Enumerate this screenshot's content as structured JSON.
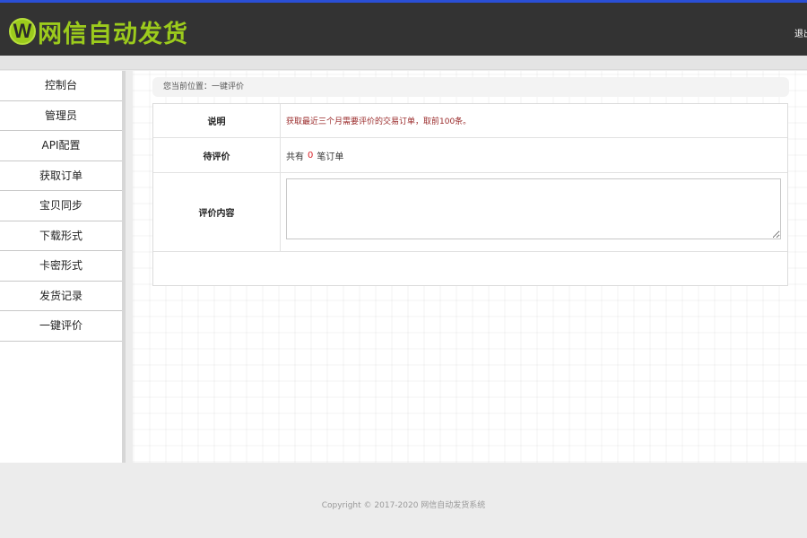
{
  "header": {
    "logo_badge": "W",
    "logo_text": "网信自动发货",
    "logout_label": "退出"
  },
  "sidebar": {
    "items": [
      {
        "label": "控制台"
      },
      {
        "label": "管理员"
      },
      {
        "label": "API配置"
      },
      {
        "label": "获取订单"
      },
      {
        "label": "宝贝同步"
      },
      {
        "label": "下载形式"
      },
      {
        "label": "卡密形式"
      },
      {
        "label": "发货记录"
      },
      {
        "label": "一键评价"
      }
    ]
  },
  "main": {
    "breadcrumb": "您当前位置：一键评价",
    "rows": {
      "desc_label": "说明",
      "desc_value": "获取最近三个月需要评价的交易订单，取前100条。",
      "pending_label": "待评价",
      "pending_prefix": "共有",
      "pending_count": "0",
      "pending_suffix": "笔订单",
      "content_label": "评价内容",
      "content_value": ""
    }
  },
  "footer": {
    "copyright": "Copyright © 2017-2020 网信自动发货系统"
  },
  "colors": {
    "header_bg": "#333333",
    "accent_green": "#9ccb1c",
    "top_border": "#2a4fd6",
    "count_red": "#d8232a"
  }
}
